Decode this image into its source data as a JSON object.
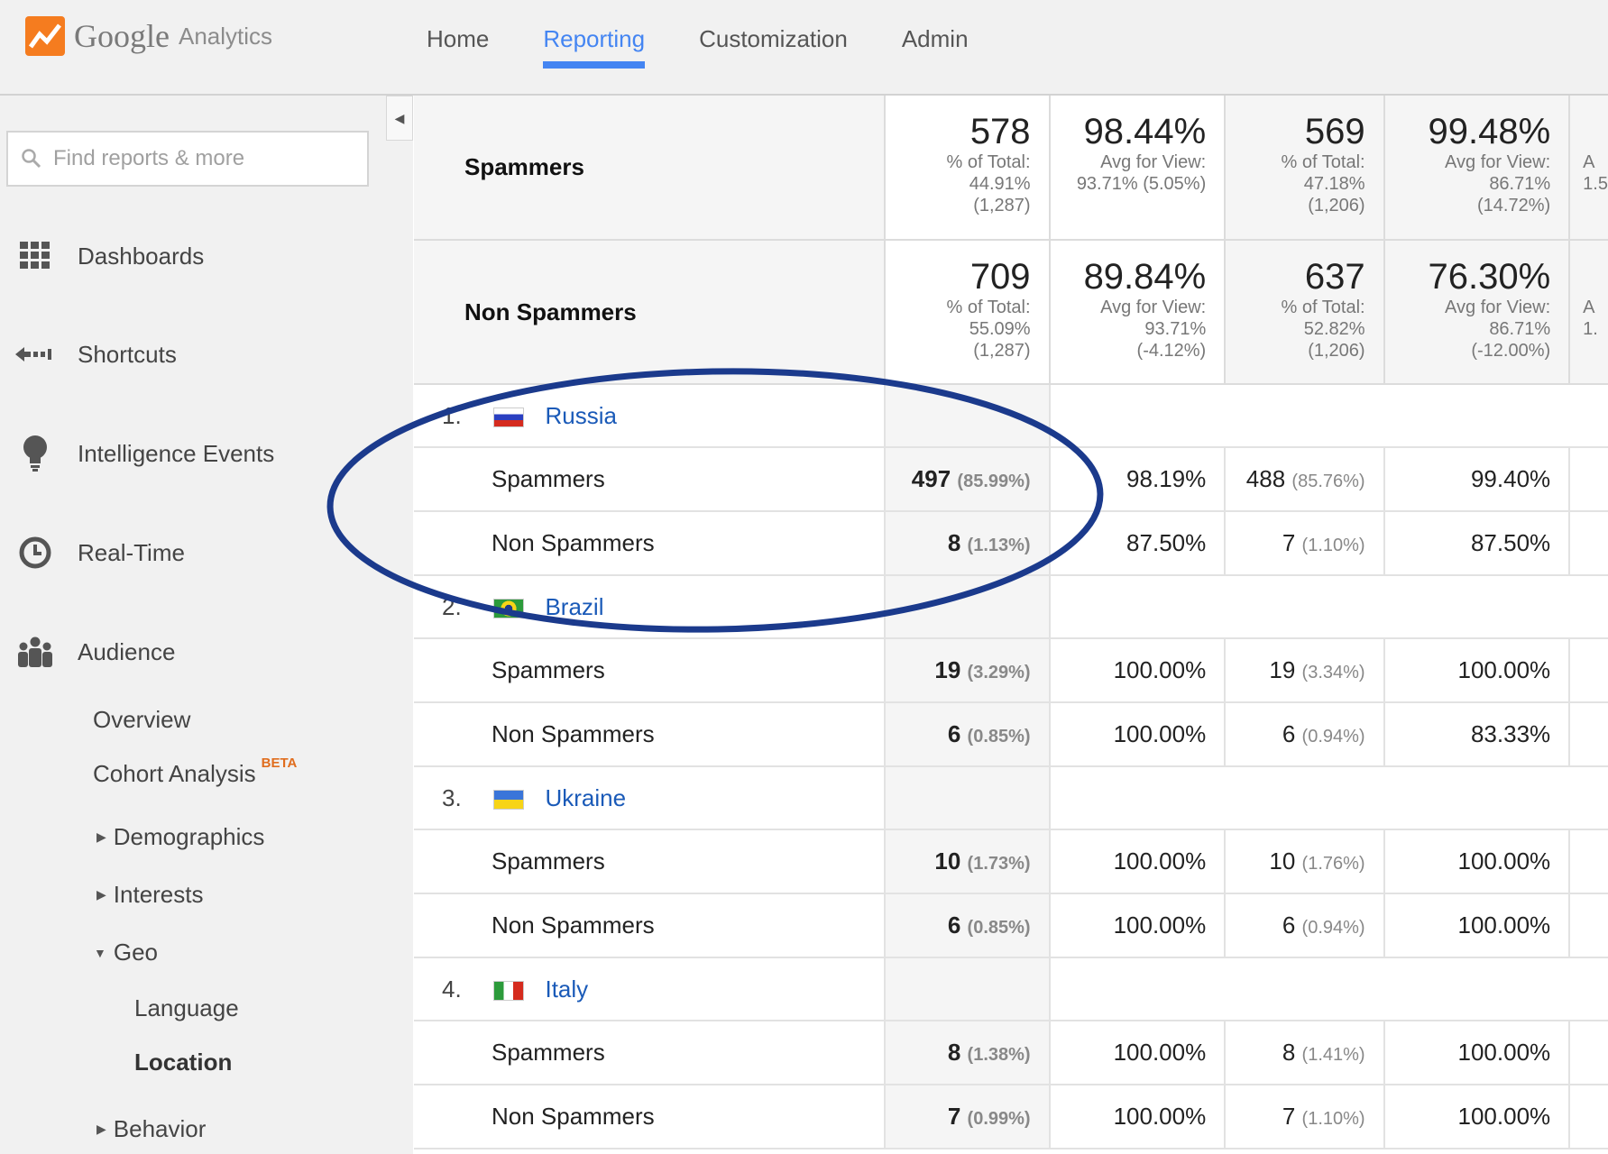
{
  "app": {
    "brand": "Google",
    "product": "Analytics"
  },
  "nav": {
    "tabs": [
      "Home",
      "Reporting",
      "Customization",
      "Admin"
    ],
    "active": "Reporting"
  },
  "sidebar": {
    "search_placeholder": "Find reports & more",
    "main": [
      "Dashboards",
      "Shortcuts",
      "Intelligence Events",
      "Real-Time",
      "Audience"
    ],
    "audience": {
      "overview": "Overview",
      "cohort": "Cohort Analysis",
      "cohort_badge": "BETA",
      "demographics": "Demographics",
      "interests": "Interests",
      "geo": "Geo",
      "language": "Language",
      "location": "Location",
      "behavior": "Behavior"
    }
  },
  "summary": [
    {
      "label": "Spammers",
      "c1": {
        "value": "578",
        "l1": "% of Total:",
        "l2": "44.91%",
        "l3": "(1,287)"
      },
      "c2": {
        "value": "98.44%",
        "l1": "Avg for View:",
        "l2": "93.71% (5.05%)"
      },
      "c3": {
        "value": "569",
        "l1": "% of Total:",
        "l2": "47.18%",
        "l3": "(1,206)"
      },
      "c4": {
        "value": "99.48%",
        "l1": "Avg for View:",
        "l2": "86.71%",
        "l3": "(14.72%)"
      },
      "c5": {
        "l1": "A",
        "l2": "1.5"
      }
    },
    {
      "label": "Non Spammers",
      "c1": {
        "value": "709",
        "l1": "% of Total:",
        "l2": "55.09%",
        "l3": "(1,287)"
      },
      "c2": {
        "value": "89.84%",
        "l1": "Avg for View:",
        "l2": "93.71%",
        "l3": "(-4.12%)"
      },
      "c3": {
        "value": "637",
        "l1": "% of Total:",
        "l2": "52.82%",
        "l3": "(1,206)"
      },
      "c4": {
        "value": "76.30%",
        "l1": "Avg for View:",
        "l2": "86.71%",
        "l3": "(-12.00%)"
      },
      "c5": {
        "l1": "A",
        "l2": "1."
      }
    }
  ],
  "groups": [
    {
      "num": "1.",
      "country": "Russia",
      "flag_colors": [
        "#ffffff",
        "#2a3fc1",
        "#d52b1e"
      ],
      "rows": [
        {
          "label": "Spammers",
          "v1": "497",
          "p1": "(85.99%)",
          "v2": "98.19%",
          "v3": "488",
          "p3": "(85.76%)",
          "v4": "99.40%"
        },
        {
          "label": "Non Spammers",
          "v1": "8",
          "p1": "(1.13%)",
          "v2": "87.50%",
          "v3": "7",
          "p3": "(1.10%)",
          "v4": "87.50%"
        }
      ]
    },
    {
      "num": "2.",
      "country": "Brazil",
      "flag_colors": [
        "#2c9b3b",
        "#f7d417",
        "#1e3a8a"
      ],
      "rows": [
        {
          "label": "Spammers",
          "v1": "19",
          "p1": "(3.29%)",
          "v2": "100.00%",
          "v3": "19",
          "p3": "(3.34%)",
          "v4": "100.00%"
        },
        {
          "label": "Non Spammers",
          "v1": "6",
          "p1": "(0.85%)",
          "v2": "100.00%",
          "v3": "6",
          "p3": "(0.94%)",
          "v4": "83.33%"
        }
      ]
    },
    {
      "num": "3.",
      "country": "Ukraine",
      "flag_colors": [
        "#3a75d9",
        "#f7d417"
      ],
      "rows": [
        {
          "label": "Spammers",
          "v1": "10",
          "p1": "(1.73%)",
          "v2": "100.00%",
          "v3": "10",
          "p3": "(1.76%)",
          "v4": "100.00%"
        },
        {
          "label": "Non Spammers",
          "v1": "6",
          "p1": "(0.85%)",
          "v2": "100.00%",
          "v3": "6",
          "p3": "(0.94%)",
          "v4": "100.00%"
        }
      ]
    },
    {
      "num": "4.",
      "country": "Italy",
      "flag_colors": [
        "#2c9b3b",
        "#ffffff",
        "#d52b1e"
      ],
      "rows": [
        {
          "label": "Spammers",
          "v1": "8",
          "p1": "(1.38%)",
          "v2": "100.00%",
          "v3": "8",
          "p3": "(1.41%)",
          "v4": "100.00%"
        },
        {
          "label": "Non Spammers",
          "v1": "7",
          "p1": "(0.99%)",
          "v2": "100.00%",
          "v3": "7",
          "p3": "(1.10%)",
          "v4": "100.00%"
        }
      ]
    }
  ],
  "colors": {
    "accent": "#4485f2",
    "annotation": "#1b3a8c",
    "link": "#1a5ab8"
  }
}
